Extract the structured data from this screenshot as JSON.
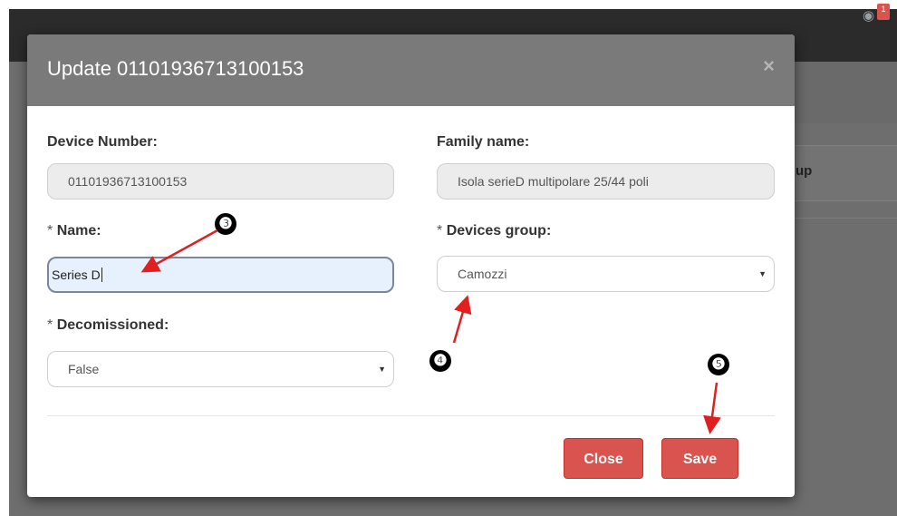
{
  "background": {
    "column_header": "up",
    "notification_count": "1"
  },
  "modal": {
    "title": "Update 01101936713100153",
    "close_icon": "×",
    "fields": {
      "device_number": {
        "label": "Device Number:",
        "value": "01101936713100153"
      },
      "family_name": {
        "label": "Family name:",
        "value": "Isola serieD multipolare 25/44 poli"
      },
      "name": {
        "required": "*",
        "label": "Name:",
        "value": "Series D"
      },
      "devices_group": {
        "required": "*",
        "label": "Devices group:",
        "value": "Camozzi"
      },
      "decomissioned": {
        "required": "*",
        "label": "Decomissioned:",
        "value": "False"
      }
    },
    "buttons": {
      "close": "Close",
      "save": "Save"
    }
  },
  "annotations": {
    "step3": "❸",
    "step4": "❹",
    "step5": "❺"
  },
  "colors": {
    "danger": "#d9534f",
    "header": "#7a7a7a",
    "arrow": "#e02020"
  }
}
